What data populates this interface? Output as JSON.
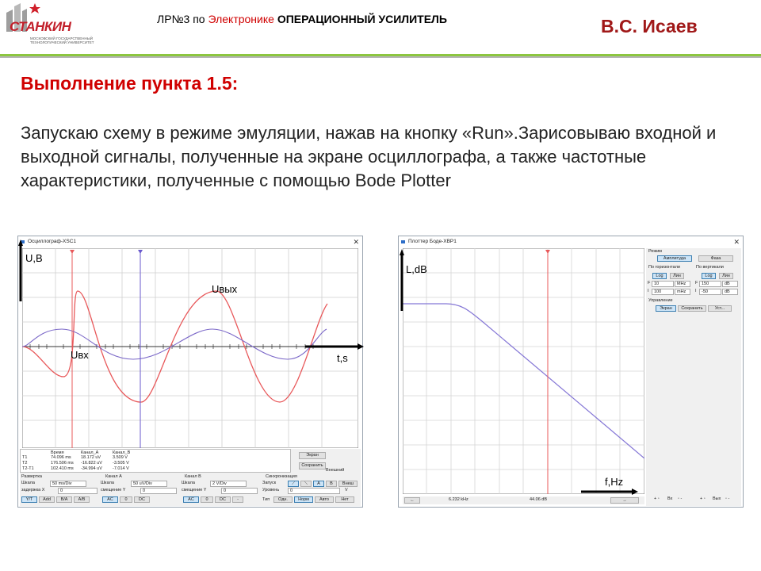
{
  "header": {
    "logo_text": "СТАНКИН",
    "logo_subtext": "МОСКОВСКИЙ ГОСУДАРСТВЕННЫЙ ТЕХНОЛОГИЧЕСКИЙ УНИВЕРСИТЕТ",
    "course_prefix": "ЛР№3 по ",
    "course_subject": "Электронике",
    "course_topic": " ОПЕРАЦИОННЫЙ УСИЛИТЕЛЬ",
    "author": "В.С. Исаев"
  },
  "section_title": "Выполнение пункта 1.5:",
  "body_text": "Запускаю схему в режиме эмуляции, нажав на кнопку «Run».Зарисовываю входной и выходной сигналы, полученные на экране осциллографа, а также частотные характеристики, полученные с помощью  Bode Plotter",
  "oscilloscope": {
    "title": "Осциллограф-XSC1",
    "annot_y": "U,B",
    "annot_x": "t,s",
    "label_out": "Uвых",
    "label_in": "Uвх",
    "readout": {
      "headers": [
        "Время",
        "Канал_А",
        "Канал_В"
      ],
      "rows": [
        {
          "name": "T1",
          "time": "74.096 ms",
          "a": "18.172 uV",
          "b": "3.509 V"
        },
        {
          "name": "T2",
          "time": "176.506 ms",
          "a": "-16.822 uV",
          "b": "-3.505 V"
        },
        {
          "name": "T2-T1",
          "time": "102.410 ms",
          "a": "-34.994 uV",
          "b": "-7.014 V"
        }
      ]
    },
    "btn_screen": "Экран",
    "btn_save": "Сохранить",
    "ext_trigger": "Внешний",
    "timebase": {
      "title": "Развертка",
      "scale_label": "Шкала",
      "scale": "50 ms/Div",
      "xpos_label": "задержка X",
      "xpos": "0",
      "btns": [
        "Y/T",
        "Add",
        "B/A",
        "A/B"
      ]
    },
    "channel_a": {
      "title": "Канал А",
      "scale_label": "Шкала",
      "scale": "50 uV/Div",
      "ypos_label": "смещение Y",
      "ypos": "0",
      "btns": [
        "AC",
        "0",
        "DC"
      ]
    },
    "channel_b": {
      "title": "Канал B",
      "scale_label": "Шкала",
      "scale": "2 V/Div",
      "ypos_label": "смещение Y",
      "ypos": "0",
      "btns": [
        "AC",
        "0",
        "DC",
        "-"
      ]
    },
    "trigger": {
      "title": "Синхронизация",
      "edge_label": "Запуск",
      "edge_btns": [
        "A",
        "B",
        "Внеш"
      ],
      "level_label": "Уровень",
      "level": "0",
      "level_unit": "V",
      "type_label": "Тип",
      "type_btns": [
        "Одн.",
        "Норм",
        "Авто",
        "Нет"
      ]
    }
  },
  "bode": {
    "title": "Плоттер Боде-XBP1",
    "annot_y": "L,dB",
    "annot_x": "f,Hz",
    "mode_label": "Режим",
    "mode_btns": [
      "Амплитуда",
      "Фаза"
    ],
    "horizontal_label": "По горизонтали",
    "vertical_label": "По вертикали",
    "h_btns": [
      "Log",
      "Лин"
    ],
    "v_btns": [
      "Log",
      "Лин"
    ],
    "h_final": {
      "prefix": "F",
      "value": "10",
      "unit": "MHz"
    },
    "h_initial": {
      "prefix": "I",
      "value": "100",
      "unit": "mHz"
    },
    "v_final": {
      "prefix": "F",
      "value": "150",
      "unit": "dB"
    },
    "v_initial": {
      "prefix": "I",
      "value": "-50",
      "unit": "dB"
    },
    "controls_label": "Управление",
    "control_btns": [
      "Экран",
      "Сохранить",
      "Уст..."
    ],
    "status_freq": "6.232 kHz",
    "status_gain": "44.06 dB",
    "terminals": [
      "Вх",
      "Вых"
    ]
  }
}
